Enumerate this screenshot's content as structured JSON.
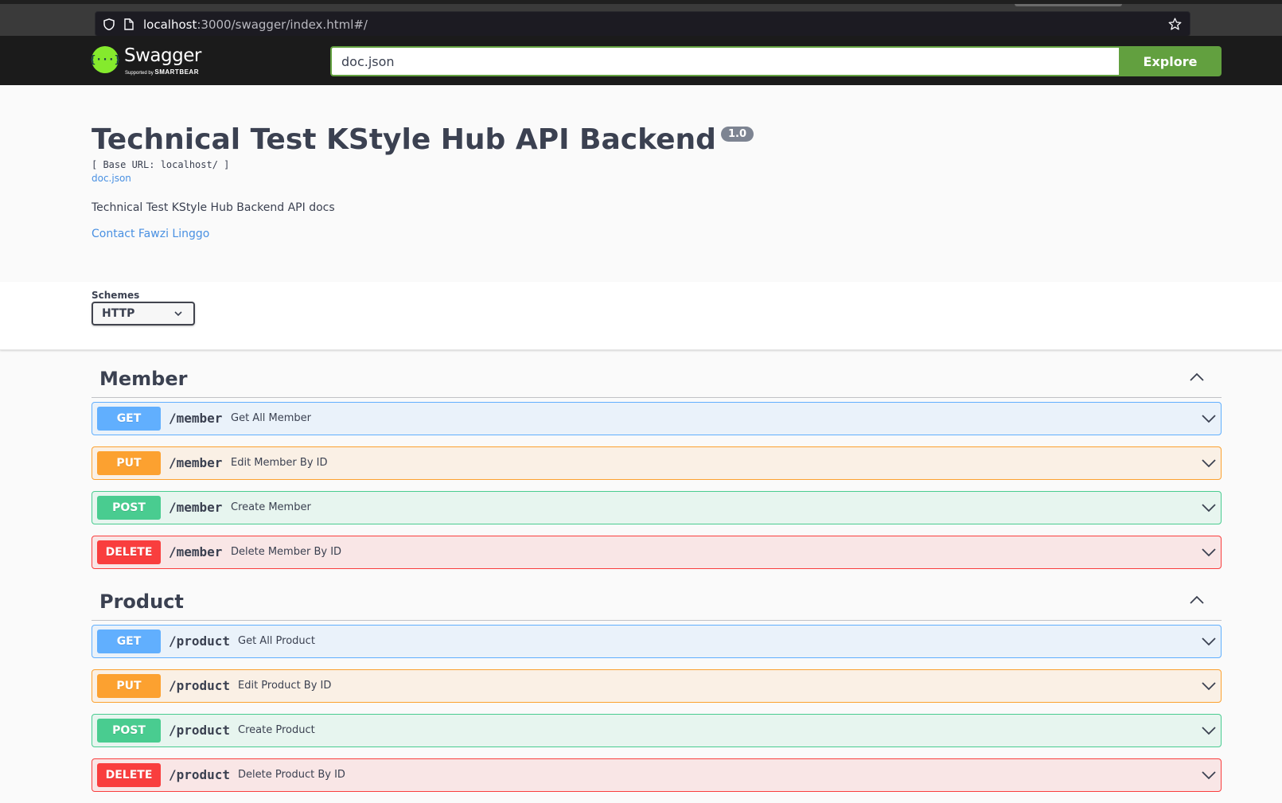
{
  "browser": {
    "url_host": "localhost",
    "url_rest": ":3000/swagger/index.html#/"
  },
  "topbar": {
    "logo_name": "Swagger",
    "logo_supported": "Supported by",
    "logo_brand": "SMARTBEAR",
    "explore_value": "doc.json",
    "explore_button": "Explore",
    "accent_color": "#62a03f"
  },
  "info": {
    "title": "Technical Test KStyle Hub API Backend",
    "version": "1.0",
    "base_url": "[ Base URL: localhost/ ]",
    "doc_link": "doc.json",
    "description": "Technical Test KStyle Hub Backend API docs",
    "contact": "Contact Fawzi Linggo"
  },
  "schemes": {
    "label": "Schemes",
    "selected": "HTTP"
  },
  "tags": [
    {
      "name": "Member",
      "operations": [
        {
          "method": "GET",
          "path": "/member",
          "summary": "Get All Member"
        },
        {
          "method": "PUT",
          "path": "/member",
          "summary": "Edit Member By ID"
        },
        {
          "method": "POST",
          "path": "/member",
          "summary": "Create Member"
        },
        {
          "method": "DELETE",
          "path": "/member",
          "summary": "Delete Member By ID"
        }
      ]
    },
    {
      "name": "Product",
      "operations": [
        {
          "method": "GET",
          "path": "/product",
          "summary": "Get All Product"
        },
        {
          "method": "PUT",
          "path": "/product",
          "summary": "Edit Product By ID"
        },
        {
          "method": "POST",
          "path": "/product",
          "summary": "Create Product"
        },
        {
          "method": "DELETE",
          "path": "/product",
          "summary": "Delete Product By ID"
        }
      ]
    }
  ],
  "method_colors": {
    "GET": "#61affe",
    "PUT": "#fca130",
    "POST": "#49cc90",
    "DELETE": "#f93e3e"
  }
}
